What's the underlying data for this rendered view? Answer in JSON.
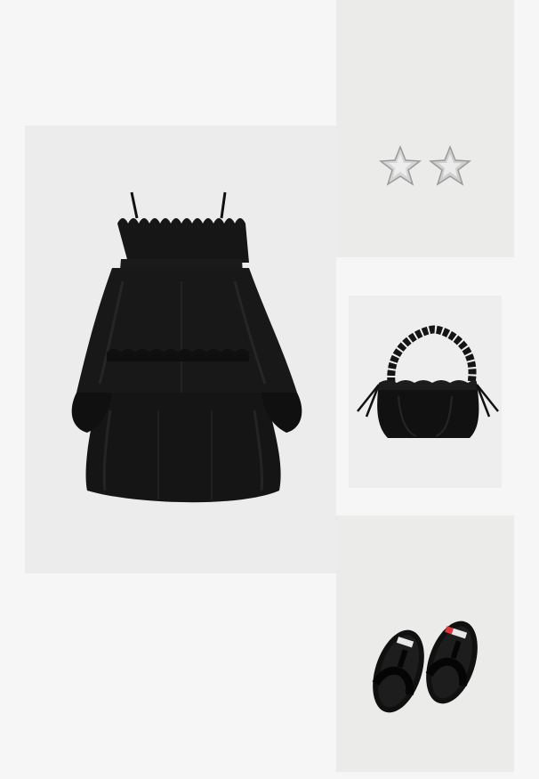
{
  "board": {
    "items": [
      {
        "id": "dress",
        "icon": "black-tiered-ruffle-dress"
      },
      {
        "id": "earrings",
        "icon": "silver-star-earrings"
      },
      {
        "id": "bag",
        "icon": "black-ruched-handbag"
      },
      {
        "id": "sandals",
        "icon": "black-thong-sandals"
      }
    ],
    "colors": {
      "background": "#f6f6f6",
      "tile": "#ececec",
      "garment": "#141414",
      "silver": "#c9c9c9"
    }
  }
}
